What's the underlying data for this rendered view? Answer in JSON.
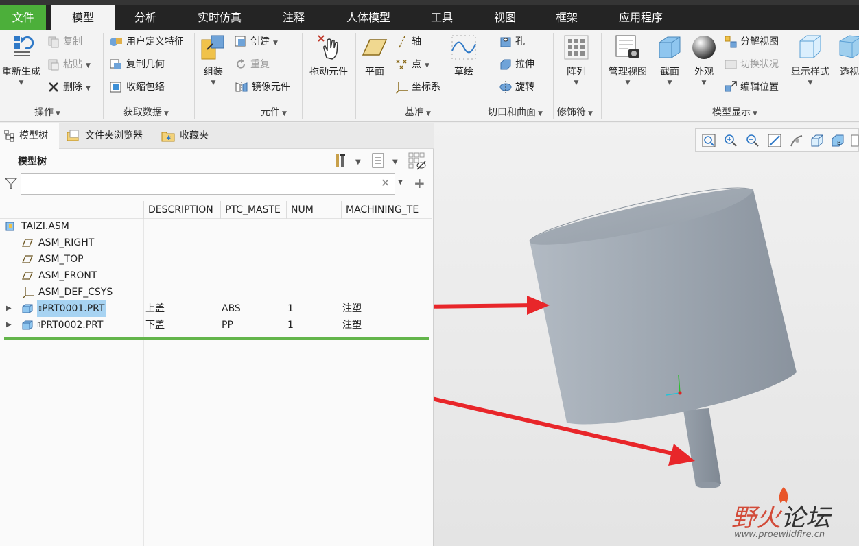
{
  "menu": {
    "tabs": [
      "文件",
      "模型",
      "分析",
      "实时仿真",
      "注释",
      "人体模型",
      "工具",
      "视图",
      "框架",
      "应用程序"
    ]
  },
  "ribbon": {
    "groups": [
      "操作",
      "获取数据",
      "元件",
      "基准",
      "切口和曲面",
      "修饰符",
      "模型显示"
    ],
    "regenerate": "重新生成",
    "copy": "复制",
    "paste": "粘贴",
    "delete": "删除",
    "user_defined_feature": "用户定义特征",
    "copy_geometry": "复制几何",
    "shrinkwrap": "收缩包络",
    "assemble": "组装",
    "create": "创建",
    "repeat": "重复",
    "mirror_component": "镜像元件",
    "drag_components": "拖动元件",
    "plane": "平面",
    "axis": "轴",
    "point": "点",
    "csys": "坐标系",
    "sketch": "草绘",
    "hole": "孔",
    "extrude": "拉伸",
    "revolve": "旋转",
    "pattern": "阵列",
    "manage_views": "管理视图",
    "section": "截面",
    "appearance": "外观",
    "exploded_view": "分解视图",
    "toggle_status": "切换状况",
    "edit_position": "编辑位置",
    "display_style": "显示样式",
    "perspective": "透视"
  },
  "nav": {
    "tabs": [
      "模型树",
      "文件夹浏览器",
      "收藏夹"
    ]
  },
  "tree": {
    "title": "模型树",
    "search_value": "",
    "columns": [
      "DESCRIPTION",
      "PTC_MASTE",
      "NUM",
      "MACHINING_TE"
    ],
    "root": "TAIZI.ASM",
    "features": [
      "ASM_RIGHT",
      "ASM_TOP",
      "ASM_FRONT",
      "ASM_DEF_CSYS"
    ],
    "parts": [
      {
        "name": "PRT0001.PRT",
        "description": "上盖",
        "material": "ABS",
        "num": "1",
        "machining": "注塑"
      },
      {
        "name": "PRT0002.PRT",
        "description": "下盖",
        "material": "PP",
        "num": "1",
        "machining": "注塑"
      }
    ]
  },
  "watermark": {
    "text_a": "野火",
    "text_b": "论坛",
    "url": "www.proewildfire.cn"
  },
  "colors": {
    "file_tab": "#4caf3a",
    "selection": "#a7d3f2",
    "arrow": "#e8262a",
    "model": "#a3acb6"
  }
}
